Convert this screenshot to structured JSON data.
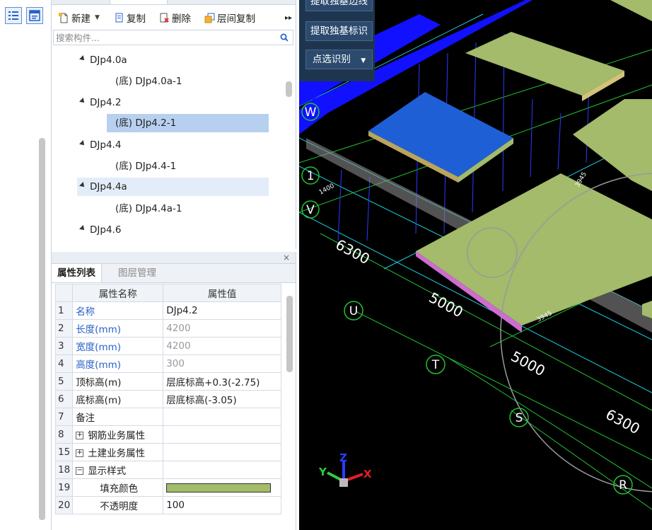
{
  "toolbar": {
    "new_label": "新建",
    "copy_label": "复制",
    "delete_label": "删除",
    "floor_copy_label": "层间复制",
    "more": "▸▸"
  },
  "search": {
    "placeholder": "搜索构件..."
  },
  "tree": [
    {
      "label": "DJp4.0a",
      "kind": "group"
    },
    {
      "label": "(底)  DJp4.0a-1",
      "kind": "leaf"
    },
    {
      "label": "DJp4.2",
      "kind": "group"
    },
    {
      "label": "(底)  DJp4.2-1",
      "kind": "leaf",
      "state": "selected"
    },
    {
      "label": "DJp4.4",
      "kind": "group"
    },
    {
      "label": "(底)  DJp4.4-1",
      "kind": "leaf"
    },
    {
      "label": "DJp4.4a",
      "kind": "group",
      "state": "hover"
    },
    {
      "label": "(底)  DJp4.4a-1",
      "kind": "leaf"
    },
    {
      "label": "DJp4.6",
      "kind": "group"
    }
  ],
  "props": {
    "close": "×",
    "tab_active": "属性列表",
    "tab_inactive": "图层管理",
    "col_name": "属性名称",
    "col_value": "属性值",
    "rows": [
      {
        "n": "1",
        "name": "名称",
        "value": "DJp4.2"
      },
      {
        "n": "2",
        "name": "长度(mm)",
        "value": "4200"
      },
      {
        "n": "3",
        "name": "宽度(mm)",
        "value": "4200"
      },
      {
        "n": "4",
        "name": "高度(mm)",
        "value": "300"
      },
      {
        "n": "5",
        "name": "顶标高(m)",
        "value": "层底标高+0.3(-2.75)"
      },
      {
        "n": "6",
        "name": "底标高(m)",
        "value": "层底标高(-3.05)"
      },
      {
        "n": "7",
        "name": "备注",
        "value": ""
      },
      {
        "n": "8",
        "name": "钢筋业务属性",
        "value": "",
        "expander": "+"
      },
      {
        "n": "15",
        "name": "土建业务属性",
        "value": "",
        "expander": "+"
      },
      {
        "n": "18",
        "name": "显示样式",
        "value": "",
        "expander": "−"
      },
      {
        "n": "19",
        "name": "填充颜色",
        "value": ""
      },
      {
        "n": "20",
        "name": "不透明度",
        "value": "100"
      }
    ]
  },
  "viewer": {
    "btn1": "提取独基边线",
    "btn2": "提取独基标识",
    "btn3": "点选识别",
    "axis_labels": [
      "W",
      "V",
      "U",
      "T",
      "S",
      "R"
    ],
    "axis_num_1": "1",
    "dims": [
      "6300",
      "5000",
      "5000",
      "6300"
    ],
    "small_dims": [
      "3945",
      "1400",
      "3945"
    ],
    "gizmo": {
      "x": "X",
      "y": "Y",
      "z": "Z"
    }
  },
  "colors": {
    "selected": "#b8d0ef",
    "slab": "#a3bb6a",
    "slab_selected": "#1f5fd6",
    "beam": "#1111ff",
    "accent": "#2961c8"
  }
}
